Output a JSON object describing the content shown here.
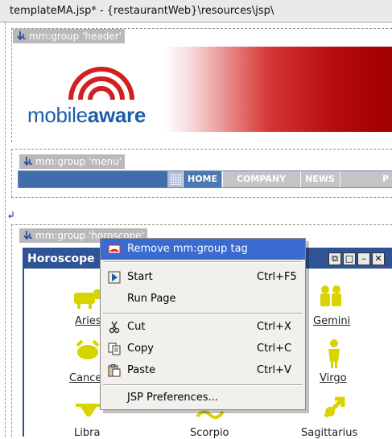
{
  "window": {
    "title": "templateMA.jsp* - {restaurantWeb}\\resources\\jsp\\"
  },
  "groups": {
    "header": "mm:group 'header'",
    "menu": "mm:group 'menu'",
    "horoscope": "mm:group 'horoscope'"
  },
  "logo": {
    "part1": "mobile",
    "part2": "aware"
  },
  "menu": {
    "items": [
      "HOME",
      "COMPANY",
      "NEWS",
      "P"
    ]
  },
  "portlet": {
    "title": "Horoscope",
    "signs": [
      "Aries",
      "Gemini",
      "Cance",
      "Virgo",
      "Libra",
      "Scorpio",
      "Sagittarius"
    ]
  },
  "context_menu": {
    "items": [
      {
        "label": "Remove mm:group tag",
        "shortcut": ""
      },
      {
        "label": "Start",
        "shortcut": "Ctrl+F5"
      },
      {
        "label": "Run Page",
        "shortcut": ""
      },
      {
        "label": "Cut",
        "shortcut": "Ctrl+X"
      },
      {
        "label": "Copy",
        "shortcut": "Ctrl+C"
      },
      {
        "label": "Paste",
        "shortcut": "Ctrl+V"
      },
      {
        "label": "JSP Preferences...",
        "shortcut": ""
      }
    ]
  },
  "colors": {
    "brand_red": "#b50b0b",
    "brand_blue": "#1f5ca8",
    "highlight": "#3a6bd1",
    "portlet_header": "#2f5395"
  }
}
